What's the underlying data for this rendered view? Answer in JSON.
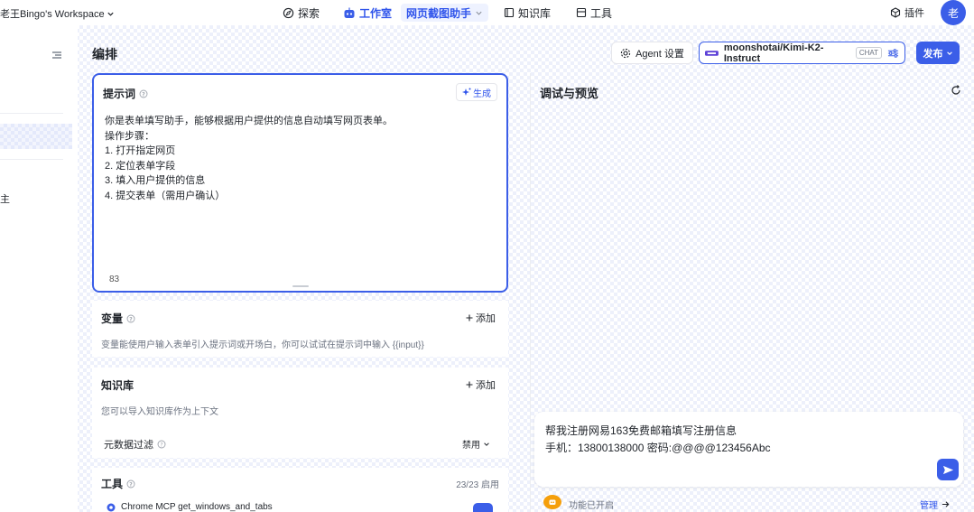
{
  "topbar": {
    "workspace": "老王Bingo's Workspace",
    "nav": [
      {
        "label": "探索",
        "icon": "explore-icon"
      },
      {
        "label": "工作室",
        "icon": "robot-icon"
      },
      {
        "label": "网页截图助手",
        "icon": "chevron-down-icon"
      },
      {
        "label": "知识库",
        "icon": "book-icon"
      },
      {
        "label": "工具",
        "icon": "tool-icon"
      },
      {
        "label": "插件",
        "icon": "cube-icon"
      }
    ],
    "avatar": "老"
  },
  "sidebar": {
    "partial_label": "主"
  },
  "editor": {
    "title": "编排",
    "prompt": {
      "title": "提示词",
      "generate_label": "生成",
      "text": "你是表单填写助手，能够根据用户提供的信息自动填写网页表单。\n操作步骤：\n1. 打开指定网页\n2. 定位表单字段\n3. 填入用户提供的信息\n4. 提交表单（需用户确认）",
      "char_count": "83"
    },
    "variables": {
      "title": "变量",
      "add_label": "添加",
      "desc": "变量能使用户输入表单引入提示词或开场白，你可以试试在提示词中输入 {{input}}"
    },
    "knowledge": {
      "title": "知识库",
      "add_label": "添加",
      "desc": "您可以导入知识库作为上下文",
      "metadata_filter": "元数据过滤",
      "metadata_value": "禁用"
    },
    "tools": {
      "title": "工具",
      "count": "23/23 启用",
      "item": "Chrome MCP  get_windows_and_tabs"
    }
  },
  "header_right": {
    "agent_settings": "Agent 设置",
    "model": "moonshotai/Kimi-K2-Instruct",
    "model_badge": "CHAT",
    "publish": "发布"
  },
  "debug": {
    "title": "调试与预览",
    "input_text": "帮我注册网易163免费邮箱填写注册信息\n手机：13800138000 密码:@@@@123456Abc",
    "footer_status": "功能已开启",
    "footer_manage": "管理"
  },
  "colors": {
    "accent": "#3b5ee8",
    "accent_text": "#2f54eb"
  }
}
